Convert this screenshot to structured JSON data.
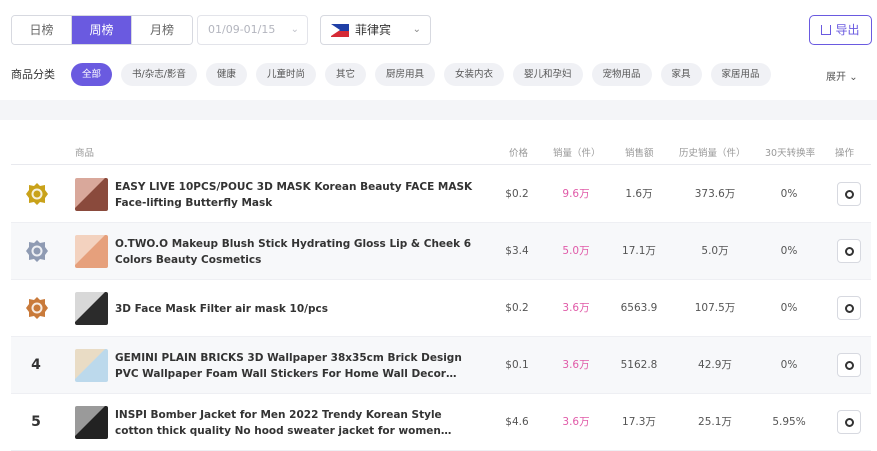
{
  "period_tabs": [
    {
      "label": "日榜"
    },
    {
      "label": "周榜"
    },
    {
      "label": "月榜"
    }
  ],
  "date_range": {
    "value": "01/09-01/15"
  },
  "country": {
    "label": "菲律宾",
    "flag_icon": "philippines-flag-icon"
  },
  "export_label": "导出",
  "category_label": "商品分类",
  "categories": [
    {
      "label": "全部"
    },
    {
      "label": "书/杂志/影音"
    },
    {
      "label": "健康"
    },
    {
      "label": "儿童时尚"
    },
    {
      "label": "其它"
    },
    {
      "label": "厨房用具"
    },
    {
      "label": "女装内衣"
    },
    {
      "label": "婴儿和孕妇"
    },
    {
      "label": "宠物用品"
    },
    {
      "label": "家具"
    },
    {
      "label": "家居用品"
    }
  ],
  "expand_label": "展开",
  "table": {
    "headers": {
      "product": "商品",
      "price": "价格",
      "sales": "销量（件）",
      "revenue": "销售额",
      "history_sales": "历史销量（件）",
      "conversion": "30天转换率",
      "action": "操作"
    },
    "rows": [
      {
        "rank": "",
        "medal": "gold",
        "name": "EASY LIVE 10PCS/POUC 3D MASK Korean Beauty FACE MASK Face-lifting Butterfly Mask",
        "price": "$0.2",
        "sales": "9.6万",
        "revenue": "1.6万",
        "history_sales": "373.6万",
        "conversion": "0%"
      },
      {
        "rank": "",
        "medal": "silver",
        "name": "O.TWO.O Makeup Blush Stick Hydrating Gloss Lip & Cheek 6 Colors Beauty Cosmetics",
        "price": "$3.4",
        "sales": "5.0万",
        "revenue": "17.1万",
        "history_sales": "5.0万",
        "conversion": "0%"
      },
      {
        "rank": "",
        "medal": "bronze",
        "name": "3D Face Mask Filter air mask 10/pcs",
        "price": "$0.2",
        "sales": "3.6万",
        "revenue": "6563.9",
        "history_sales": "107.5万",
        "conversion": "0%"
      },
      {
        "rank": "4",
        "medal": "",
        "name": "GEMINI PLAIN BRICKS 3D Wallpaper 38x35cm Brick Design PVC Wallpaper Foam Wall Stickers For Home Wall Decor Living Room",
        "price": "$0.1",
        "sales": "3.6万",
        "revenue": "5162.8",
        "history_sales": "42.9万",
        "conversion": "0%"
      },
      {
        "rank": "5",
        "medal": "",
        "name": "INSPI Bomber Jacket for Men 2022 Trendy Korean Style cotton thick quality No hood sweater jacket for women womens casual apparel sweatshirt",
        "price": "$4.6",
        "sales": "3.6万",
        "revenue": "17.3万",
        "history_sales": "25.1万",
        "conversion": "5.95%"
      }
    ]
  },
  "colors": {
    "accent": "#6a5ae0",
    "sales_pink": "#e05aa8",
    "gold": "#c9a21a",
    "silver": "#8f9bb3",
    "bronze": "#c97a3a"
  }
}
